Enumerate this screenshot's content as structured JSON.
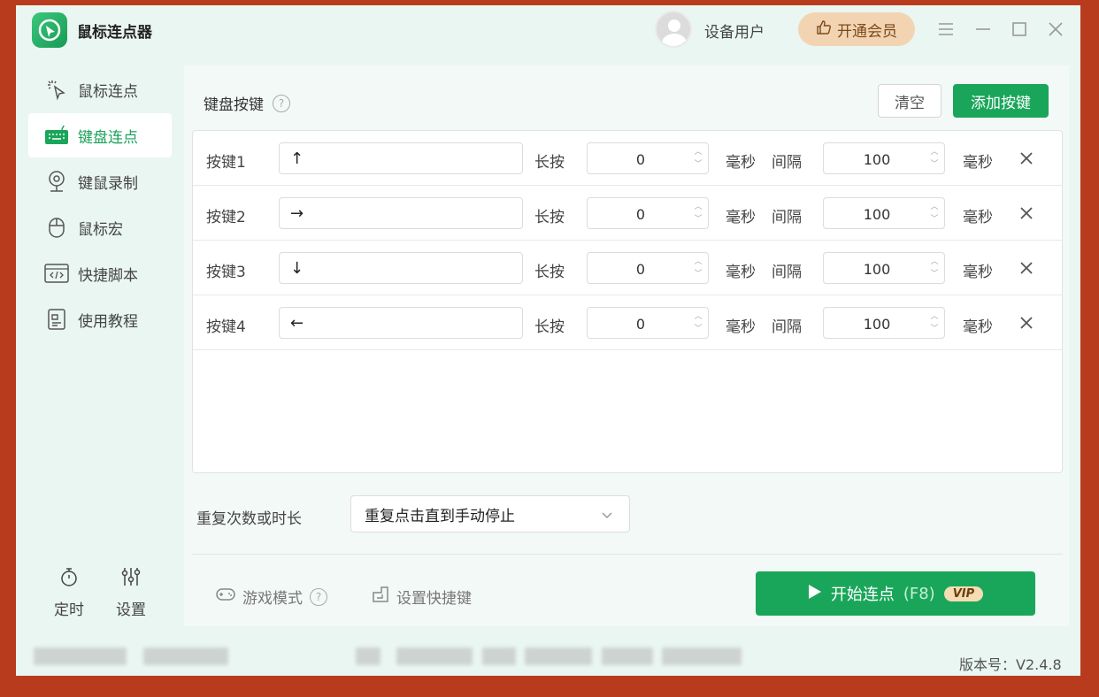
{
  "app": {
    "title": "鼠标连点器",
    "user_name": "设备用户",
    "vip_button": "开通会员"
  },
  "sidebar": {
    "items": [
      {
        "label": "鼠标连点",
        "icon": "cursor-click-icon",
        "active": false
      },
      {
        "label": "键盘连点",
        "icon": "keyboard-icon",
        "active": true
      },
      {
        "label": "键鼠录制",
        "icon": "webcam-record-icon",
        "active": false
      },
      {
        "label": "鼠标宏",
        "icon": "mouse-icon",
        "active": false
      },
      {
        "label": "快捷脚本",
        "icon": "code-script-icon",
        "active": false
      },
      {
        "label": "使用教程",
        "icon": "tutorial-doc-icon",
        "active": false
      }
    ],
    "tools": {
      "timer": "定时",
      "settings": "设置"
    }
  },
  "main": {
    "section_title": "键盘按键",
    "clear_label": "清空",
    "add_label": "添加按键",
    "rows": [
      {
        "name": "按键1",
        "key": "↑",
        "hold_label": "长按",
        "hold_ms": "0",
        "unit": "毫秒",
        "interval_label": "间隔",
        "interval_ms": "100",
        "unit2": "毫秒"
      },
      {
        "name": "按键2",
        "key": "→",
        "hold_label": "长按",
        "hold_ms": "0",
        "unit": "毫秒",
        "interval_label": "间隔",
        "interval_ms": "100",
        "unit2": "毫秒"
      },
      {
        "name": "按键3",
        "key": "↓",
        "hold_label": "长按",
        "hold_ms": "0",
        "unit": "毫秒",
        "interval_label": "间隔",
        "interval_ms": "100",
        "unit2": "毫秒"
      },
      {
        "name": "按键4",
        "key": "←",
        "hold_label": "长按",
        "hold_ms": "0",
        "unit": "毫秒",
        "interval_label": "间隔",
        "interval_ms": "100",
        "unit2": "毫秒"
      }
    ],
    "repeat_label": "重复次数或时长",
    "repeat_value": "重复点击直到手动停止",
    "game_mode": "游戏模式",
    "shortcut": "设置快捷键",
    "start_label": "开始连点",
    "start_hotkey": "(F8)",
    "vip_tag": "VIP"
  },
  "status": {
    "version": "版本号：V2.4.8"
  },
  "colors": {
    "accent": "#1aa65a",
    "background": "#eaf6f1",
    "vip": "#f3d4b2",
    "frame": "#b83b1e"
  }
}
